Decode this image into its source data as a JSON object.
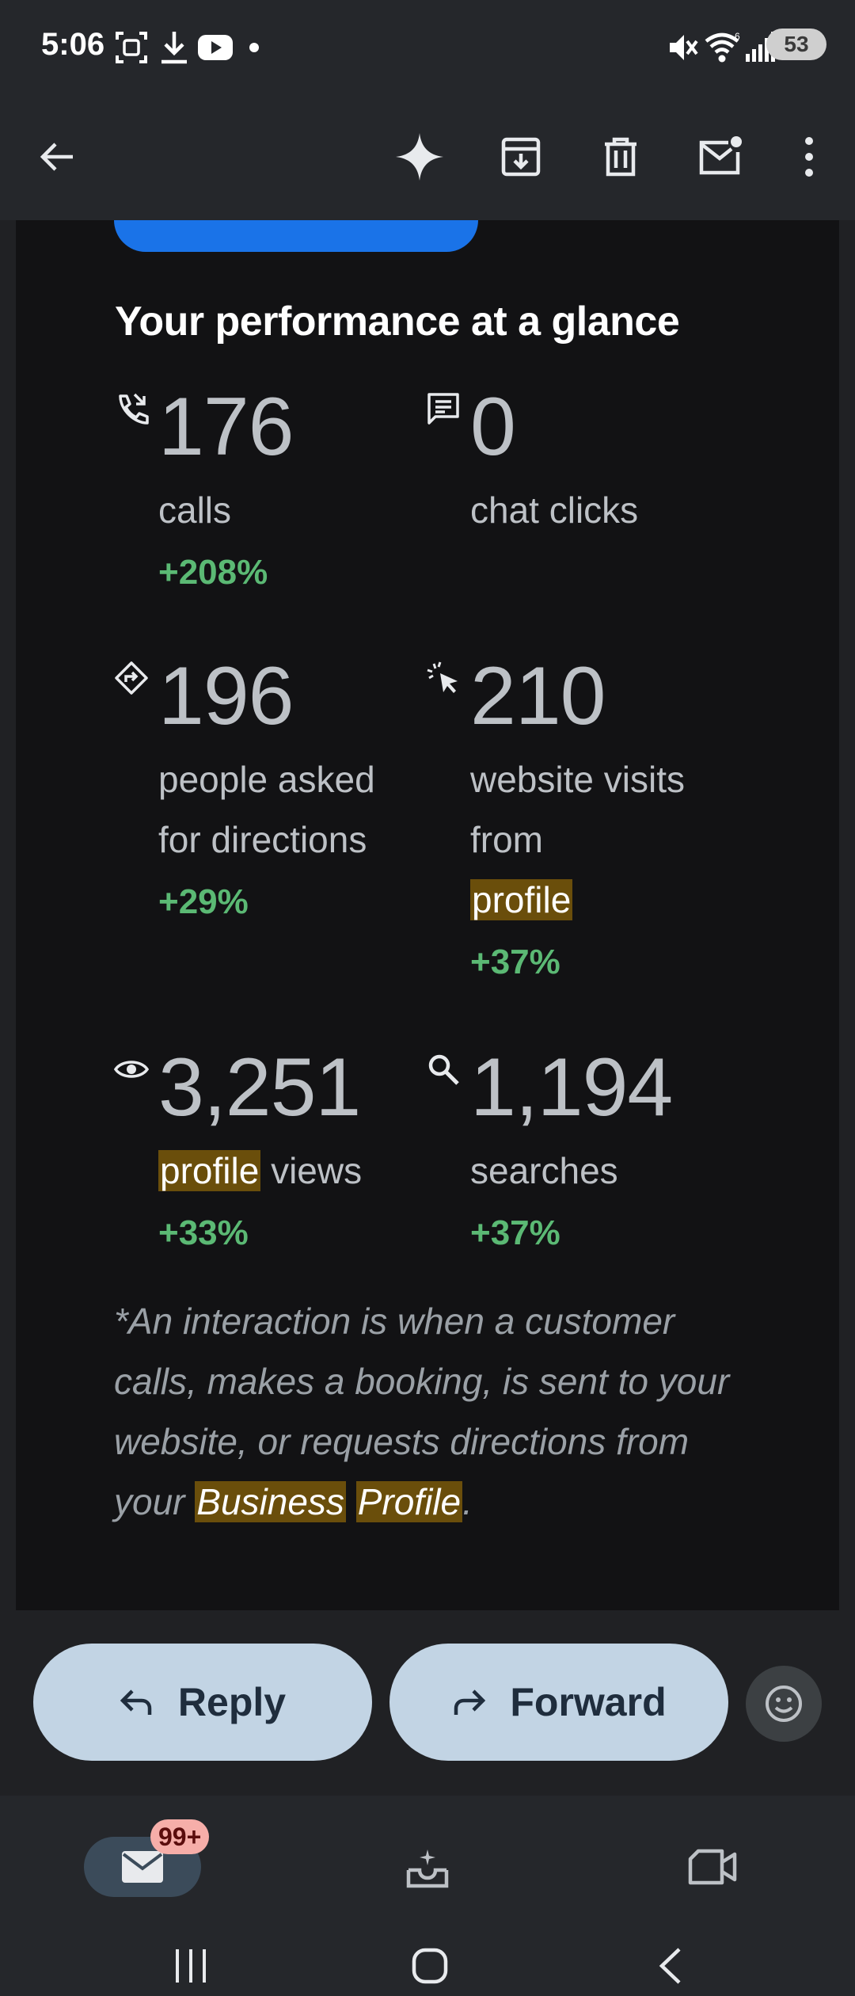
{
  "status_bar": {
    "time": "5:06",
    "battery": "53",
    "icons": [
      "screenshot-icon",
      "download-icon",
      "youtube-icon",
      "dot-icon",
      "mute-icon",
      "wifi-icon",
      "signal-icon",
      "battery-icon"
    ]
  },
  "toolbar": {
    "icons": [
      "back-arrow-icon",
      "gemini-sparkle-icon",
      "archive-icon",
      "delete-icon",
      "mark-unread-icon",
      "more-vert-icon"
    ]
  },
  "email": {
    "heading": "Your performance at a glance",
    "metrics": [
      {
        "icon": "phone-icon",
        "value": "176",
        "label": "calls",
        "change": "+208%"
      },
      {
        "icon": "chat-icon",
        "value": "0",
        "label": "chat clicks",
        "change": ""
      },
      {
        "icon": "directions-icon",
        "value": "196",
        "label_lines": [
          "people asked",
          "for directions"
        ],
        "change": "+29%"
      },
      {
        "icon": "click-icon",
        "value": "210",
        "label_lines": [
          "website visits",
          "from"
        ],
        "highlight": "profile",
        "change": "+37%"
      },
      {
        "icon": "eye-icon",
        "value": "3,251",
        "highlight": "profile",
        "label_suffix": " views",
        "change": "+33%"
      },
      {
        "icon": "search-icon",
        "value": "1,194",
        "label": "searches",
        "change": "+37%"
      }
    ],
    "footnote": {
      "text": "*An interaction is when a customer calls, makes a booking, is sent to your website, or requests directions from your",
      "highlight_1": "Business",
      "highlight_2": "Profile",
      "end": "."
    }
  },
  "actions": {
    "reply": "Reply",
    "forward": "Forward"
  },
  "bottom_nav": {
    "mail_badge": "99+"
  }
}
